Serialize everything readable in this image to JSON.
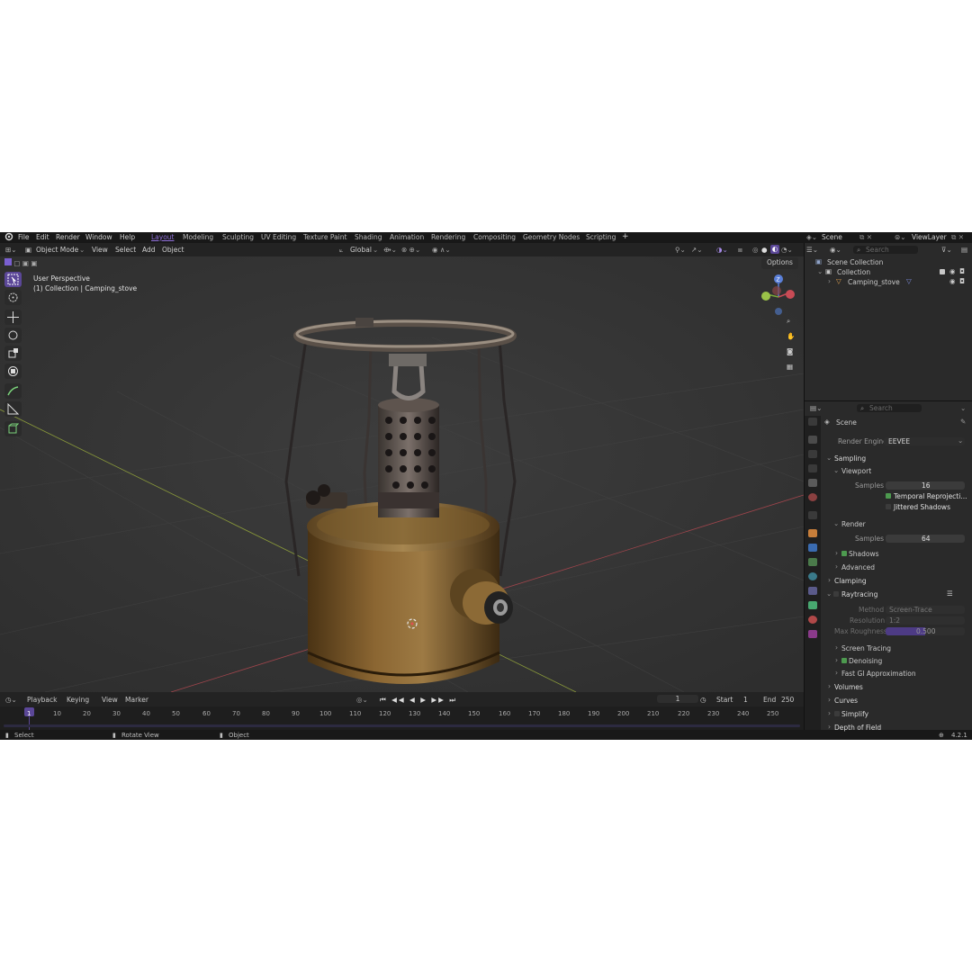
{
  "menu": {
    "items": [
      "File",
      "Edit",
      "Render",
      "Window",
      "Help"
    ],
    "workspaces": [
      "Layout",
      "Modeling",
      "Sculpting",
      "UV Editing",
      "Texture Paint",
      "Shading",
      "Animation",
      "Rendering",
      "Compositing",
      "Geometry Nodes",
      "Scripting"
    ],
    "add_tab": "+",
    "scene_label": "Scene",
    "viewlayer_label": "ViewLayer"
  },
  "viewport_header": {
    "mode": "Object Mode",
    "menus": [
      "View",
      "Select",
      "Add",
      "Object"
    ],
    "orientation": "Global",
    "options": "Options"
  },
  "viewport": {
    "perspective": "User Perspective",
    "collection_info": "(1) Collection | Camping_stove",
    "gizmo_axes": {
      "z": "Z"
    }
  },
  "outliner": {
    "search_placeholder": "Search",
    "scene_collection": "Scene Collection",
    "collection": "Collection",
    "object": "Camping_stove"
  },
  "properties": {
    "search_placeholder": "Search",
    "breadcrumb": "Scene",
    "render_engine_label": "Render Engine",
    "render_engine_value": "EEVEE",
    "sampling": "Sampling",
    "viewport_sub": "Viewport",
    "viewport_samples_label": "Samples",
    "viewport_samples_value": "16",
    "temporal_reprojection": "Temporal Reprojecti...",
    "jittered_shadows": "Jittered Shadows",
    "render_sub": "Render",
    "render_samples_label": "Samples",
    "render_samples_value": "64",
    "shadows": "Shadows",
    "advanced": "Advanced",
    "clamping": "Clamping",
    "raytracing": "Raytracing",
    "method_label": "Method",
    "method_value": "Screen-Trace",
    "resolution_label": "Resolution",
    "resolution_value": "1:2",
    "max_roughness_label": "Max Roughness",
    "max_roughness_value": "0.500",
    "max_roughness_fraction": 0.5,
    "screen_tracing": "Screen Tracing",
    "denoising": "Denoising",
    "fast_gi": "Fast GI Approximation",
    "volumes": "Volumes",
    "curves": "Curves",
    "simplify": "Simplify",
    "depth_of_field": "Depth of Field"
  },
  "timeline": {
    "menus": [
      "Playback",
      "Keying",
      "View",
      "Marker"
    ],
    "current_frame": "1",
    "start_label": "Start",
    "start_value": "1",
    "end_label": "End",
    "end_value": "250",
    "ruler": [
      "1",
      "10",
      "20",
      "30",
      "40",
      "50",
      "60",
      "70",
      "80",
      "90",
      "100",
      "110",
      "120",
      "130",
      "140",
      "150",
      "160",
      "170",
      "180",
      "190",
      "200",
      "210",
      "220",
      "230",
      "240",
      "250"
    ]
  },
  "statusbar": {
    "select": "Select",
    "rotate": "Rotate View",
    "object": "Object",
    "version": "4.2.1"
  },
  "colors": {
    "accent": "#8f6fd8",
    "active_tool": "#5b4798",
    "check": "#4d9a4f",
    "viewport_bg": "#393939"
  }
}
